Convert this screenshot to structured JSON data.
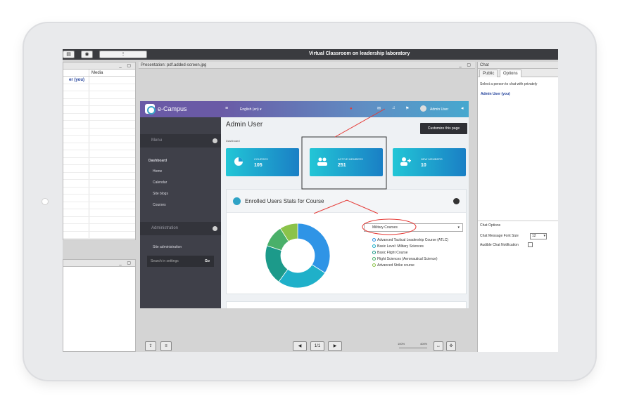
{
  "window": {
    "title": "Virtual Classroom on leadership laboratory",
    "presentation_label": "Presentation: pdf.added-screen.jpg",
    "panel_controls": "_ ▢"
  },
  "users_panel": {
    "column_media": "Media",
    "rows": [
      "er (you)",
      "",
      "",
      "",
      "",
      "",
      "",
      "",
      "",
      "",
      "",
      "",
      "",
      "",
      "",
      "",
      "",
      "",
      "",
      "",
      "",
      ""
    ]
  },
  "ecampus": {
    "brand": "e-Campus",
    "language": "English (en) ▾",
    "user_label": "Admin User",
    "page_title": "Admin User",
    "breadcrumb": "Dashboard",
    "customize_label": "Customize this page",
    "sidebar": {
      "menu_label": "Menu",
      "dashboard": "Dashboard",
      "items": [
        "Home",
        "Calendar",
        "Site blogs",
        "Courses"
      ],
      "admin_label": "Administration",
      "admin_items": [
        "Site administration"
      ],
      "search_placeholder": "Search in settings",
      "search_go": "Go"
    },
    "cards": [
      {
        "label": "COURSES",
        "value": "105"
      },
      {
        "label": "ACTIVE MEMBERS",
        "value": "251"
      },
      {
        "label": "NEW MEMBERS",
        "value": "10"
      }
    ],
    "stats_title": "Enrolled Users Stats for Course",
    "select_value": "Military Courses",
    "legend": [
      "Advanced Tactical Leadership Course (ATLC)",
      "Basic Level: Military Sciences",
      "Basic Flight Course",
      "Flight Sciences (Aeronautical Science)",
      "Advanced Strike course"
    ]
  },
  "chart_data": {
    "type": "pie",
    "categories": [
      "Advanced Tactical Leadership Course (ATLC)",
      "Basic Level: Military Sciences",
      "Basic Flight Course",
      "Flight Sciences (Aeronautical Science)",
      "Advanced Strike course"
    ],
    "values": [
      34,
      26,
      20,
      11,
      9
    ],
    "colors": [
      "#2f94e6",
      "#1fb0c9",
      "#1c9a8a",
      "#4ab06a",
      "#8bc34a"
    ],
    "donut": true
  },
  "chat": {
    "title": "Chat",
    "tabs": [
      "Public",
      "Options"
    ],
    "select_hint": "Select a person to chat with privately",
    "admin_user": "Admin User (you)",
    "options_title": "Chat Options",
    "font_size_label": "Chat Message Font Size",
    "font_size_value": "12",
    "audible_label": "Audible Chat Notification"
  },
  "bottom_controls": {
    "page_indicator": "1/1",
    "zoom_min": "100%",
    "zoom_max": "400%"
  }
}
